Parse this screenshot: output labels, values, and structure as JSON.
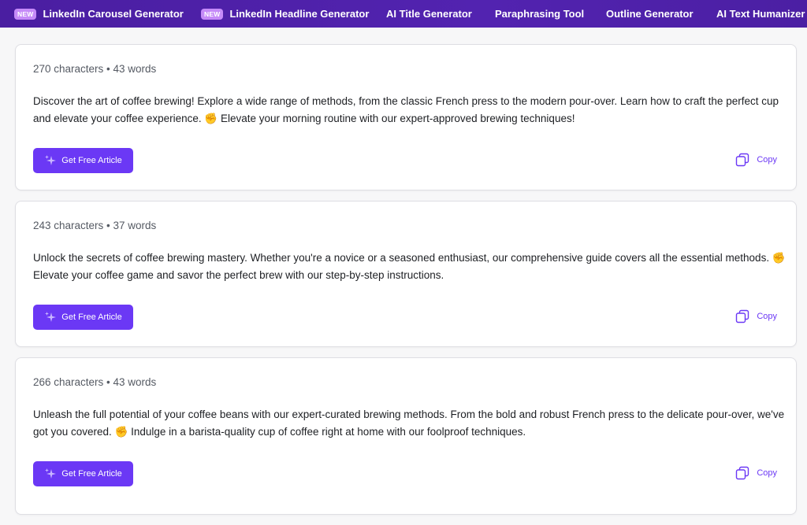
{
  "nav": {
    "items": [
      {
        "label": "LinkedIn Carousel Generator",
        "badge": "NEW"
      },
      {
        "label": "LinkedIn Headline Generator",
        "badge": "NEW"
      },
      {
        "label": "AI Title Generator"
      },
      {
        "label": "Paraphrasing Tool"
      },
      {
        "label": "Outline Generator"
      },
      {
        "label": "AI Text Humanizer"
      }
    ]
  },
  "results": [
    {
      "stats": "270 characters • 43 words",
      "text": "Discover the art of coffee brewing! Explore a wide range of methods, from the classic French press to the modern pour-over. Learn how to craft the perfect cup and elevate your coffee experience. ✊ Elevate your morning routine with our expert-approved brewing techniques!",
      "button_label": "Get Free Article",
      "copy_label": "Copy"
    },
    {
      "stats": "243 characters • 37 words",
      "text": "Unlock the secrets of coffee brewing mastery. Whether you're a novice or a seasoned enthusiast, our comprehensive guide covers all the essential methods. ✊ Elevate your coffee game and savor the perfect brew with our step-by-step instructions.",
      "button_label": "Get Free Article",
      "copy_label": "Copy"
    },
    {
      "stats": "266 characters • 43 words",
      "text": "Unleash the full potential of your coffee beans with our expert-curated brewing methods. From the bold and robust French press to the delicate pour-over, we've got you covered. ✊ Indulge in a barista-quality cup of coffee right at home with our foolproof techniques.",
      "button_label": "Get Free Article",
      "copy_label": "Copy"
    }
  ],
  "colors": {
    "nav_bg": "#4b1fa3",
    "badge_bg": "#c58af8",
    "accent": "#6b38f5",
    "card_border": "#dedee3"
  },
  "icons": {
    "button_icon": "sparkle-icon",
    "copy_icon": "copy-icon"
  }
}
